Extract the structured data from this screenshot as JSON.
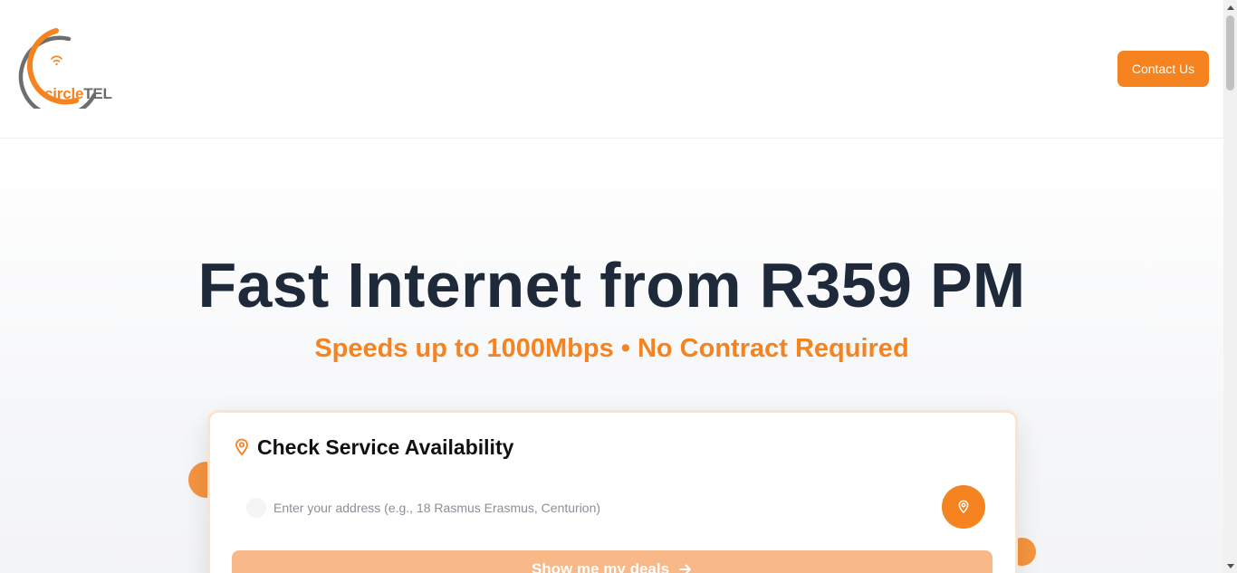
{
  "brand": {
    "name_part1": "circle",
    "name_part2": "TEL",
    "logo_icon": "wifi-icon",
    "colors": {
      "accent": "#f5831f",
      "gray": "#6b6b6b"
    }
  },
  "header": {
    "contact_label": "Contact Us"
  },
  "hero": {
    "title": "Fast Internet from R359 PM",
    "subtitle": "Speeds up to 1000Mbps • No Contract Required"
  },
  "availability": {
    "title": "Check Service Availability",
    "title_icon": "map-pin-icon",
    "address_placeholder": "Enter your address (e.g., 18 Rasmus Erasmus, Centurion)",
    "address_value": "",
    "locate_icon": "map-pin-icon",
    "deals_label": "Show me my deals",
    "deals_icon": "arrow-right-icon"
  }
}
